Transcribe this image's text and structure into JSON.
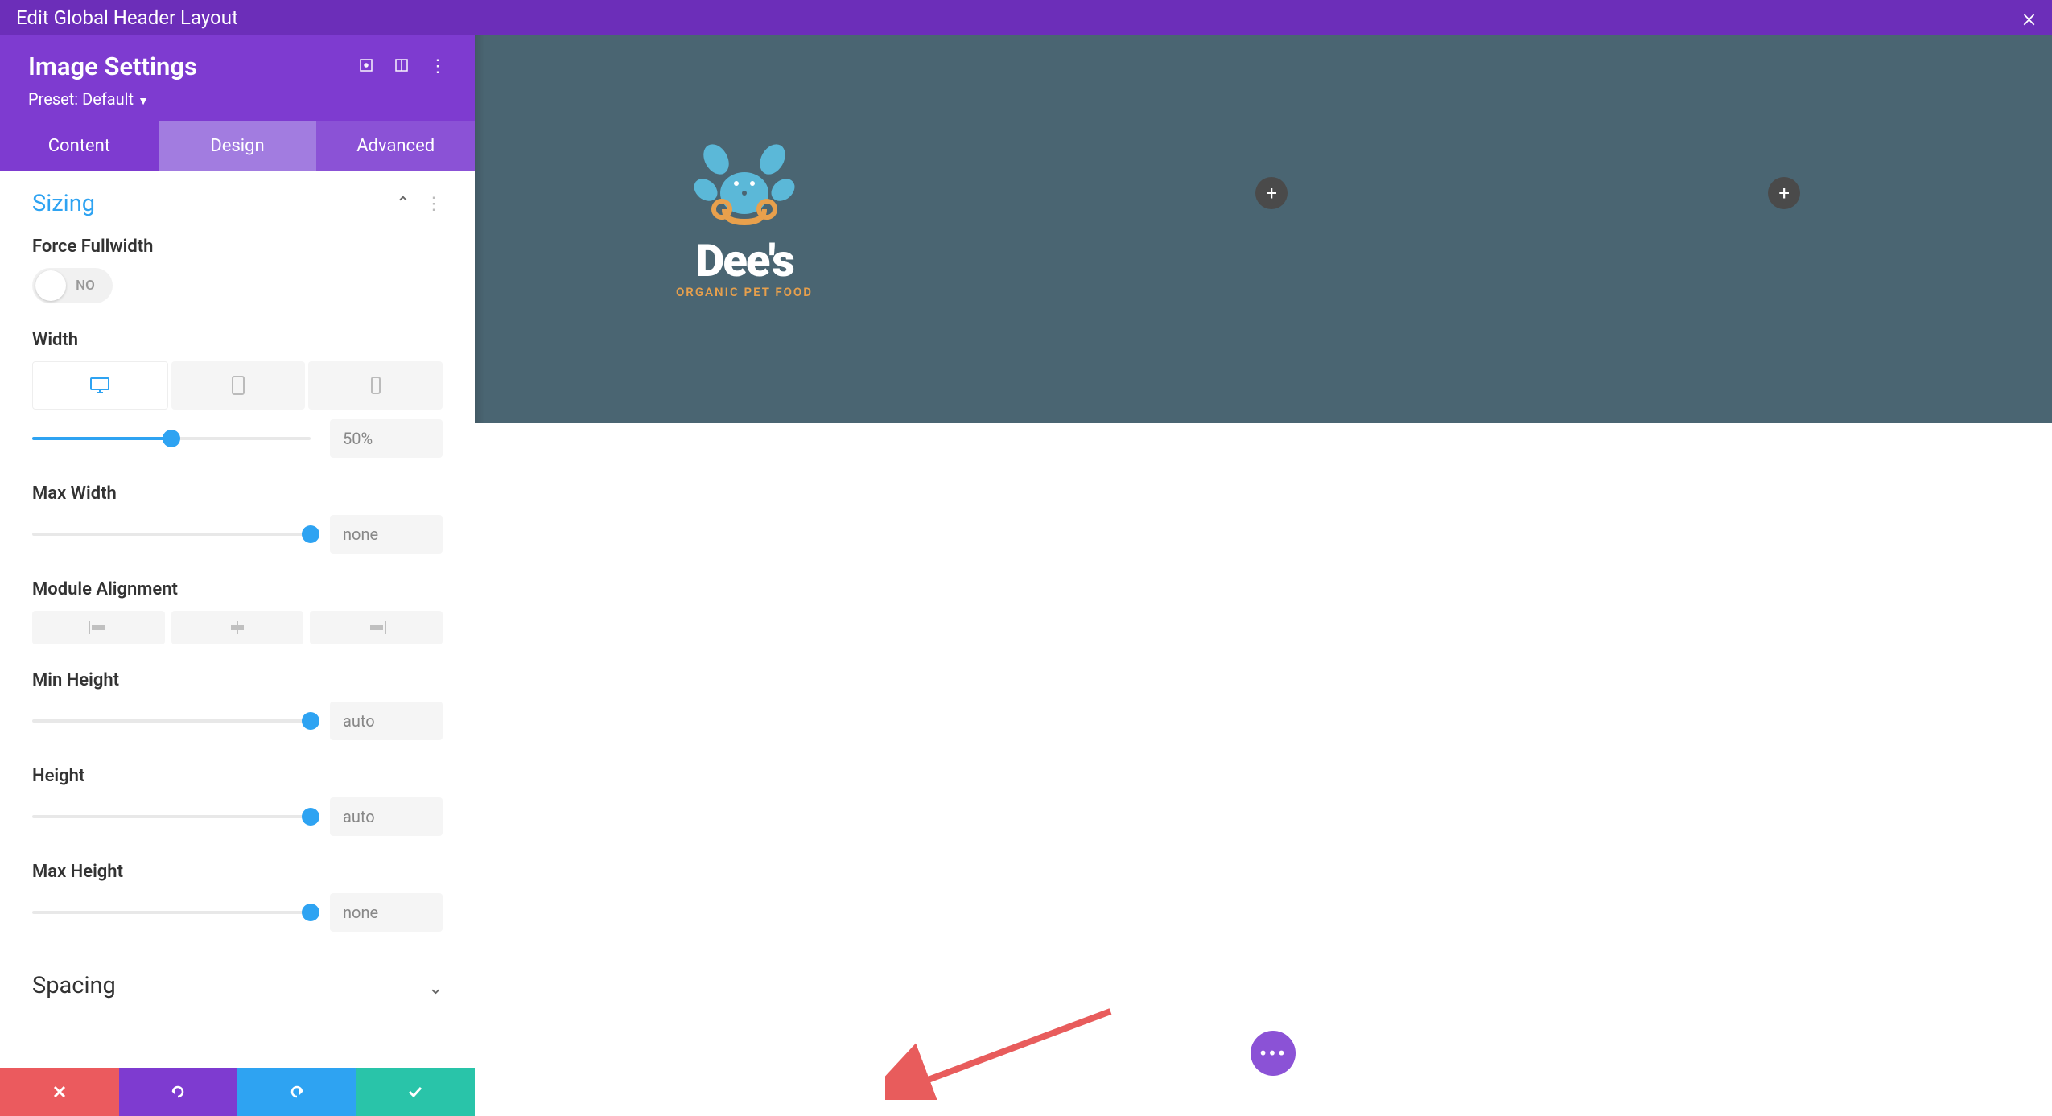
{
  "topbar": {
    "title": "Edit Global Header Layout"
  },
  "sidebar": {
    "title": "Image Settings",
    "preset_label": "Preset: Default",
    "tabs": {
      "content": "Content",
      "design": "Design",
      "advanced": "Advanced"
    },
    "sections": {
      "sizing": {
        "title": "Sizing",
        "fields": {
          "force_fullwidth": {
            "label": "Force Fullwidth",
            "toggle": "NO"
          },
          "width": {
            "label": "Width",
            "value": "50%",
            "percent": 50
          },
          "max_width": {
            "label": "Max Width",
            "value": "none",
            "percent": 100
          },
          "module_alignment": {
            "label": "Module Alignment"
          },
          "min_height": {
            "label": "Min Height",
            "value": "auto",
            "percent": 100
          },
          "height": {
            "label": "Height",
            "value": "auto",
            "percent": 100
          },
          "max_height": {
            "label": "Max Height",
            "value": "none",
            "percent": 100
          }
        }
      },
      "spacing": {
        "title": "Spacing"
      }
    }
  },
  "preview": {
    "logo_main": "Dee's",
    "logo_sub": "ORGANIC PET FOOD"
  }
}
